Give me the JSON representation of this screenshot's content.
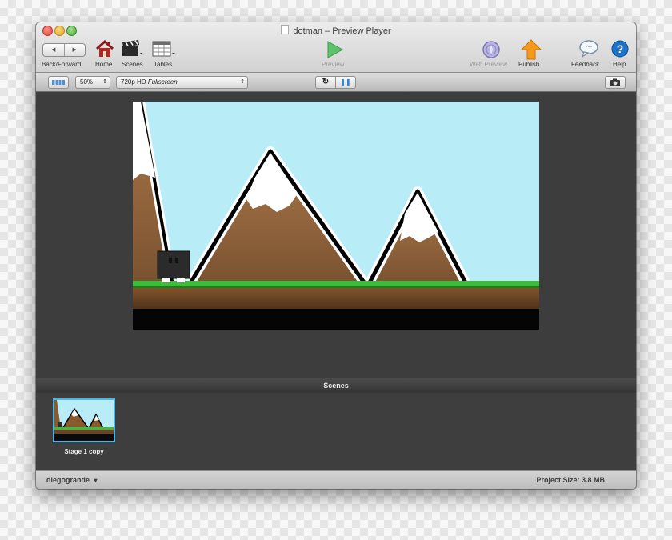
{
  "window": {
    "title": "dotman – Preview Player"
  },
  "toolbar": {
    "back_forward_label": "Back/Forward",
    "back_glyph": "◀",
    "forward_glyph": "▶",
    "home_label": "Home",
    "scenes_label": "Scenes",
    "tables_label": "Tables",
    "preview_label": "Preview",
    "web_preview_label": "Web Preview",
    "publish_label": "Publish",
    "feedback_label": "Feedback",
    "help_label": "Help",
    "help_glyph": "?",
    "feedback_glyph": "···"
  },
  "subbar": {
    "zoom_value": "50%",
    "resolution_prefix": "720p HD",
    "resolution_mode": "Fullscreen",
    "select_arrows": "⇕",
    "reload_glyph": "↻",
    "pause_glyph": "❚❚"
  },
  "scenes": {
    "header": "Scenes",
    "items": [
      {
        "label": "Stage 1 copy"
      }
    ]
  },
  "status": {
    "user": "diegogrande",
    "user_arrow": "▾",
    "project_size": "Project Size: 3.8 MB"
  },
  "colors": {
    "sky": "#b8ecf6",
    "grass": "#3dbb3a",
    "selection": "#48b7e6",
    "publish": "#f39a1c",
    "preview": "#5cc36a",
    "help": "#1d73c9"
  },
  "icons": [
    "home-icon",
    "scenes-icon",
    "tables-icon",
    "preview-play-icon",
    "web-preview-icon",
    "publish-icon",
    "feedback-icon",
    "help-icon",
    "camera-icon",
    "reload-icon",
    "pause-icon",
    "layout-icon"
  ]
}
